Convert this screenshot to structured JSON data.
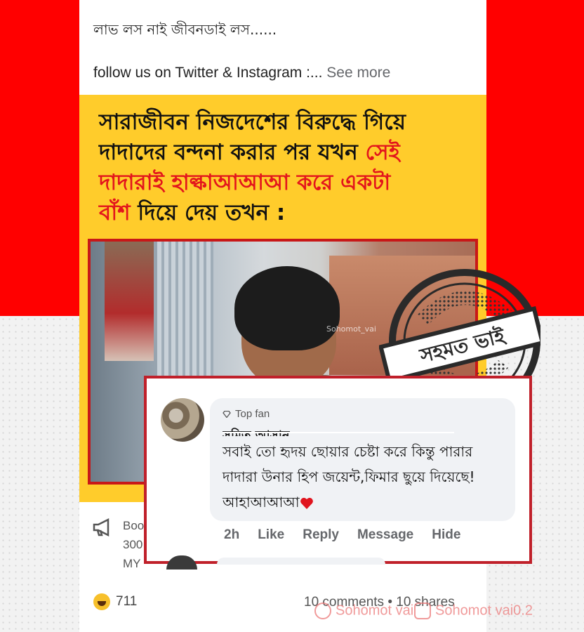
{
  "post": {
    "caption": "লাভ লস নাই জীবনডাই লস......",
    "follow_text": "follow us on Twitter & Instagram :...",
    "see_more": "See more"
  },
  "meme": {
    "line1": "সারাজীবন নিজদেশের বিরুদ্ধে গিয়ে",
    "line2_a": "দাদাদের বন্দনা করার পর যখন ",
    "line2_b": "সেই",
    "line3_a": "দাদারাই হাল্কাআআআ করে একটা",
    "line4_a": "বাঁশ",
    "line4_b": " দিয়ে দেয় তখন :",
    "photo_watermark": "Sohomot_vai"
  },
  "footer_ad": {
    "line1": "Boo",
    "line2": "300",
    "line3": "MY"
  },
  "reactions": {
    "count": "711"
  },
  "counts": {
    "comments": "10 comments",
    "separator": " • ",
    "shares": "10 shares"
  },
  "stamp": {
    "text": "সহমত ভাই"
  },
  "comment": {
    "badge": "Top fan",
    "name": "সুমিত আসান",
    "text": "সবাই তো হৃদয় ছোয়ার চেষ্টা করে কিন্তু পারার দাদারা উনার হিপ জয়েন্ট,ফিমার ছুয়ে দিয়েছে! আহাআআআ",
    "actions": {
      "time": "2h",
      "like": "Like",
      "reply": "Reply",
      "message": "Message",
      "hide": "Hide"
    }
  },
  "watermarks": {
    "twitter": "Sohomot vai",
    "instagram": "Sohomot vai0.2"
  },
  "colors": {
    "red_bg": "#ff0000",
    "meme_yellow": "#ffcc2b",
    "highlight_red": "#e3151c",
    "border_red": "#c0202a"
  }
}
